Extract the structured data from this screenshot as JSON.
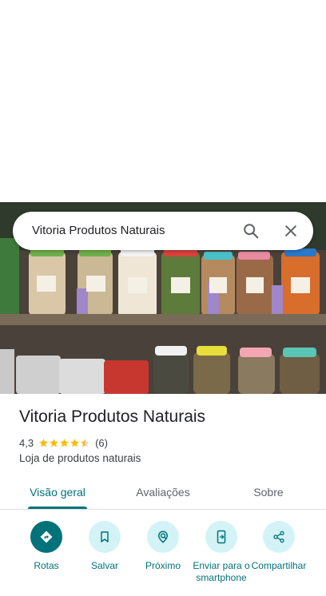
{
  "search": {
    "query": "Vitoria Produtos Naturais",
    "icons": {
      "search": "search-icon",
      "close": "close-icon"
    }
  },
  "hero": {
    "description_icon": "store-shelves-photo"
  },
  "place": {
    "name": "Vitoria Produtos Naturais",
    "rating": "4,3",
    "rating_value": 4.3,
    "stars_max": 5,
    "review_count": "(6)",
    "category": "Loja de produtos naturais"
  },
  "tabs": [
    {
      "label": "Visão geral",
      "active": true
    },
    {
      "label": "Avaliações",
      "active": false
    },
    {
      "label": "Sobre",
      "active": false
    }
  ],
  "actions": [
    {
      "label": "Rotas",
      "icon": "directions-icon"
    },
    {
      "label": "Salvar",
      "icon": "bookmark-icon"
    },
    {
      "label": "Próximo",
      "icon": "nearby-icon"
    },
    {
      "label": "Enviar para o smartphone",
      "icon": "send-to-phone-icon"
    },
    {
      "label": "Compartilhar",
      "icon": "share-icon"
    }
  ],
  "colors": {
    "accent": "#00727a",
    "accent_light": "#d4f3f7",
    "star": "#fbbc04",
    "text": "#202124",
    "secondary_text": "#5f6368"
  }
}
